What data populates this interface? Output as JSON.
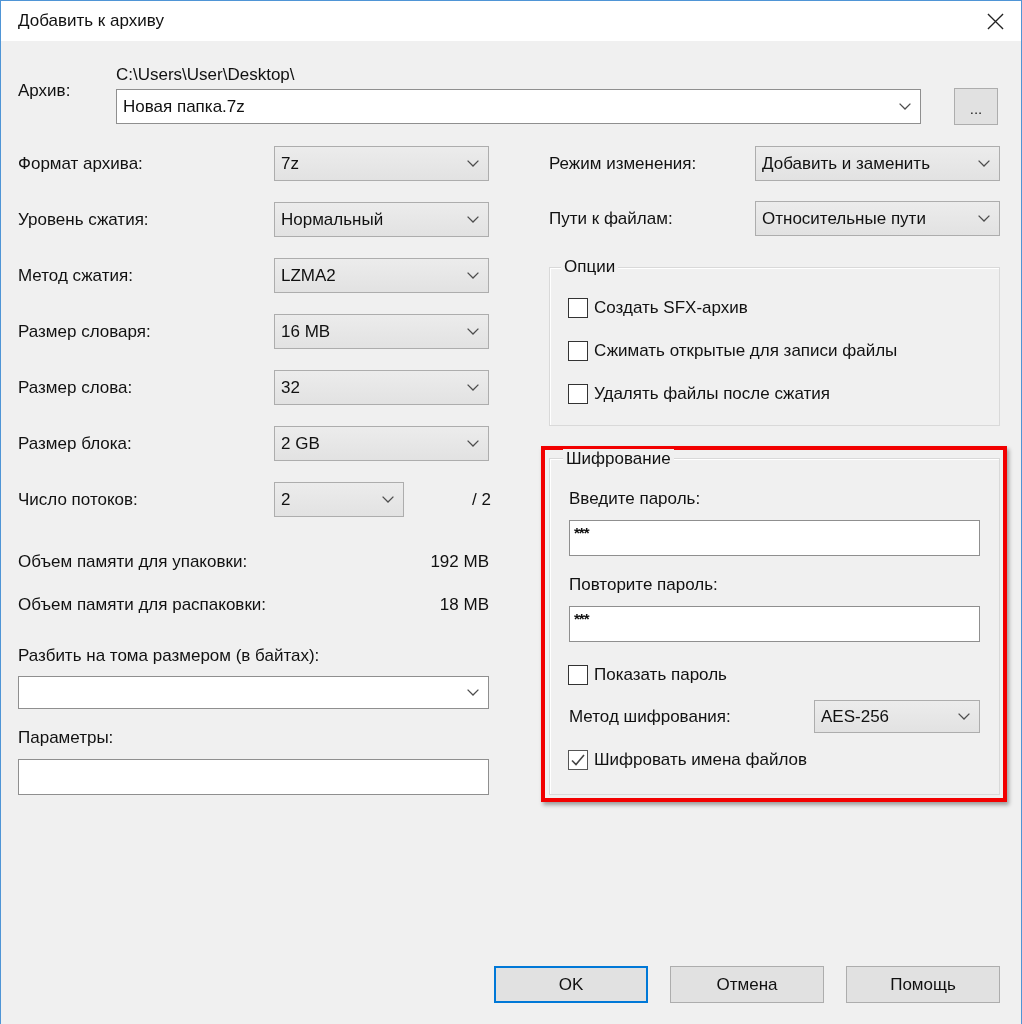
{
  "window": {
    "title": "Добавить к архиву"
  },
  "archive": {
    "label": "Архив:",
    "path": "C:\\Users\\User\\Desktop\\",
    "value": "Новая папка.7z",
    "browse_button": "..."
  },
  "settings": [
    {
      "label": "Формат архива:",
      "value": "7z"
    },
    {
      "label": "Уровень сжатия:",
      "value": "Нормальный"
    },
    {
      "label": "Метод сжатия:",
      "value": "LZMA2"
    },
    {
      "label": "Размер словаря:",
      "value": "16 MB"
    },
    {
      "label": "Размер слова:",
      "value": "32"
    },
    {
      "label": "Размер блока:",
      "value": "2 GB"
    },
    {
      "label": "Число потоков:",
      "value": "2",
      "suffix": "/ 2"
    }
  ],
  "memory": [
    {
      "label": "Объем памяти для упаковки:",
      "value": "192 MB"
    },
    {
      "label": "Объем памяти для распаковки:",
      "value": "18 MB"
    }
  ],
  "split": {
    "label": "Разбить на тома размером (в байтах):"
  },
  "parameters": {
    "label": "Параметры:"
  },
  "right_settings": [
    {
      "label": "Режим изменения:",
      "value": "Добавить и заменить"
    },
    {
      "label": "Пути к файлам:",
      "value": "Относительные пути"
    }
  ],
  "options": {
    "title": "Опции",
    "items": [
      {
        "label": "Создать SFX-архив",
        "checked": false
      },
      {
        "label": "Сжимать открытые для записи файлы",
        "checked": false
      },
      {
        "label": "Удалять файлы после сжатия",
        "checked": false
      }
    ]
  },
  "encryption": {
    "title": "Шифрование",
    "highlighted": true,
    "password_label": "Введите пароль:",
    "password": "***",
    "repeat_label": "Повторите пароль:",
    "repeat": "***",
    "show_password": {
      "label": "Показать пароль",
      "checked": false
    },
    "method_label": "Метод шифрования:",
    "method": "AES-256",
    "encrypt_names": {
      "label": "Шифровать имена файлов",
      "checked": true
    }
  },
  "buttons": [
    {
      "label": "OK",
      "default": true
    },
    {
      "label": "Отмена",
      "default": false
    },
    {
      "label": "Помощь",
      "default": false
    }
  ]
}
